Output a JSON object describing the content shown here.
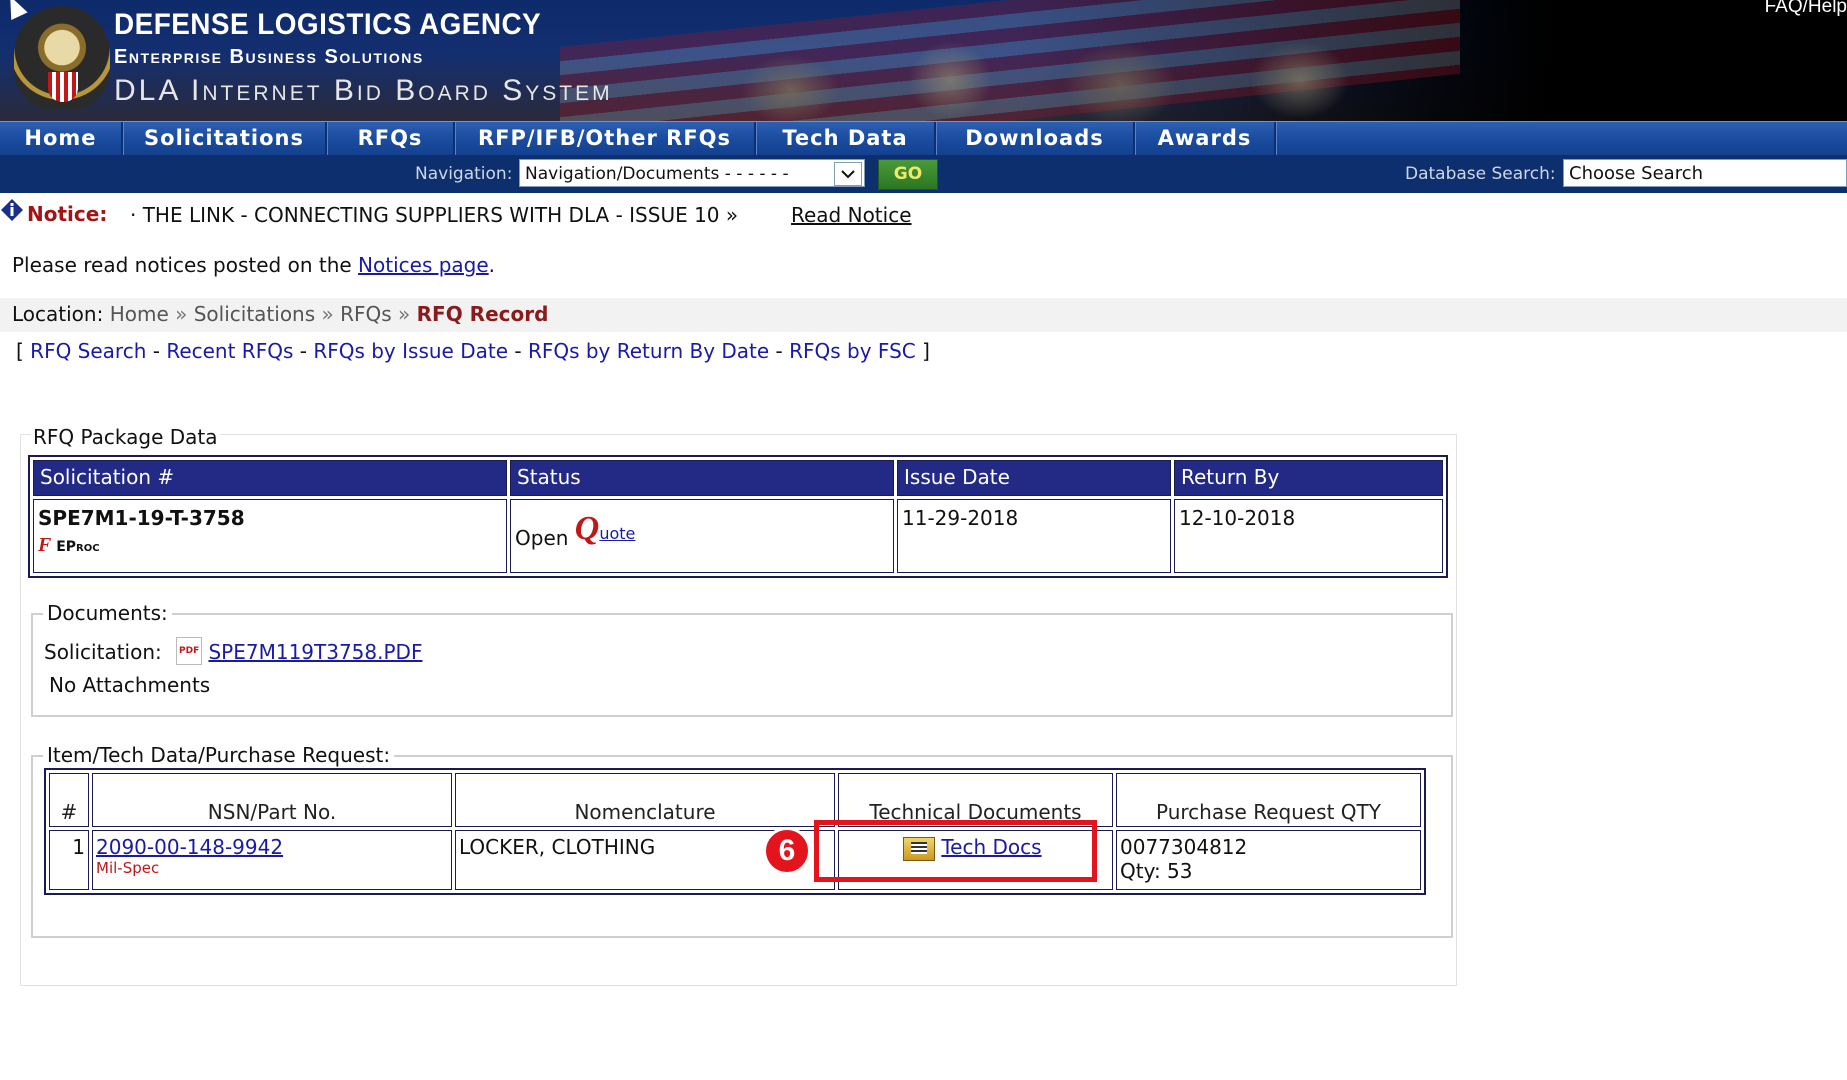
{
  "banner": {
    "title": "DEFENSE LOGISTICS AGENCY",
    "subtitle": "Enterprise Business Solutions",
    "system": "DLA Internet Bid Board System",
    "faq": "FAQ/Help"
  },
  "main_nav": [
    {
      "label": "Home"
    },
    {
      "label": "Solicitations"
    },
    {
      "label": "RFQs"
    },
    {
      "label": "RFP/IFB/Other RFQs"
    },
    {
      "label": "Tech Data"
    },
    {
      "label": "Downloads"
    },
    {
      "label": "Awards"
    }
  ],
  "subbar": {
    "nav_label": "Navigation:",
    "nav_select_value": "Navigation/Documents - - - - - -",
    "go_label": "GO",
    "db_label": "Database Search:",
    "db_select_value": "Choose Search"
  },
  "notice": {
    "label": "Notice:",
    "text": "· THE LINK - CONNECTING SUPPLIERS WITH DLA - ISSUE 10 »",
    "link": "Read Notice",
    "please_read_prefix": "Please read notices posted on the",
    "notices_link": "Notices page",
    "please_read_suffix": "."
  },
  "location": {
    "label": "Location:",
    "crumbs": [
      "Home",
      "Solicitations",
      "RFQs"
    ],
    "current": "RFQ Record",
    "sep": "»"
  },
  "rfq_links": {
    "open": "[",
    "items": [
      "RFQ Search",
      "Recent RFQs",
      "RFQs by Issue Date",
      "RFQs by Return By Date",
      "RFQs by FSC"
    ],
    "dash": "-",
    "close": "]"
  },
  "package": {
    "title": "RFQ Package Data",
    "headers": [
      "Solicitation #",
      "Status",
      "Issue Date",
      "Return By"
    ],
    "solicitation": "SPE7M1-19-T-3758",
    "eproc": "EProc",
    "status": "Open",
    "quote_q": "Q",
    "quote_rest": "uote",
    "issue_date": "11-29-2018",
    "return_by": "12-10-2018"
  },
  "documents": {
    "legend": "Documents:",
    "solicitation_label": "Solicitation:",
    "pdf_badge": "PDF",
    "pdf_link": "SPE7M119T3758.PDF",
    "attachments": "No Attachments"
  },
  "items": {
    "legend": "Item/Tech Data/Purchase Request:",
    "headers": [
      "#",
      "NSN/Part No.",
      "Nomenclature",
      "Technical Documents",
      "Purchase Request QTY"
    ],
    "rows": [
      {
        "num": "1",
        "nsn": "2090-00-148-9942",
        "spec": "Mil-Spec",
        "nomenclature": "LOCKER, CLOTHING",
        "tech_docs": "Tech Docs",
        "pr_number": "0077304812",
        "qty": "Qty: 53"
      }
    ]
  },
  "annotation": {
    "step": "6",
    "color": "#e3141b"
  }
}
